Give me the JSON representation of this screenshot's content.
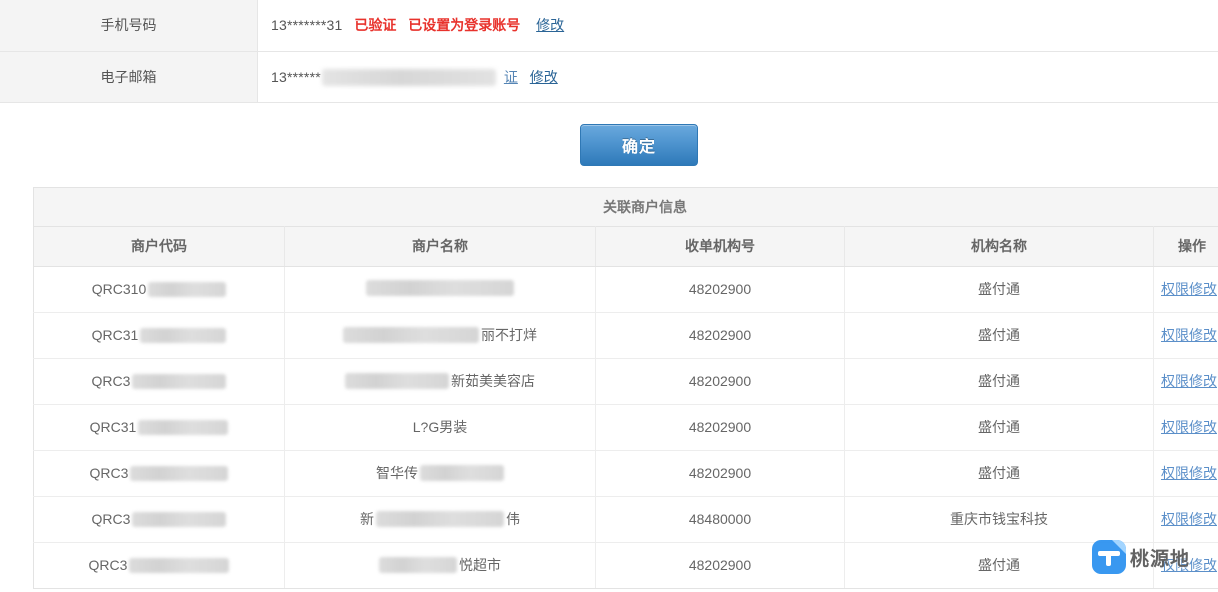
{
  "account_info": {
    "rows": [
      {
        "label": "手机号码",
        "value": "13*******31",
        "status_primary": "已验证",
        "status_secondary": "已设置为登录账号",
        "edit_link": "修改",
        "redacted": false
      },
      {
        "label": "电子邮箱",
        "value": "13******",
        "status_primary": "",
        "status_secondary": "",
        "verify_link": "证",
        "edit_link": "修改",
        "redacted": true
      }
    ]
  },
  "confirm_button": {
    "label": "确定"
  },
  "merchant_table": {
    "caption": "关联商户信息",
    "columns": [
      "商户代码",
      "商户名称",
      "收单机构号",
      "机构名称",
      "操作"
    ],
    "action_label": "权限修改",
    "rows": [
      {
        "code_prefix": "QRC310",
        "code_redact_width": 78,
        "name_prefix": "",
        "name_suffix": "",
        "name_redact_width": 148,
        "acq_no": "48202900",
        "org_name": "盛付通",
        "action": "权限修改"
      },
      {
        "code_prefix": "QRC31",
        "code_redact_width": 86,
        "name_prefix": "",
        "name_suffix": "丽不打烊",
        "name_redact_width": 136,
        "acq_no": "48202900",
        "org_name": "盛付通",
        "action": "权限修改"
      },
      {
        "code_prefix": "QRC3",
        "code_redact_width": 94,
        "name_prefix": "",
        "name_suffix": "新茹美美容店",
        "name_redact_width": 104,
        "acq_no": "48202900",
        "org_name": "盛付通",
        "action": "权限修改"
      },
      {
        "code_prefix": "QRC31",
        "code_redact_width": 90,
        "name_prefix": "L?G男装",
        "name_suffix": "",
        "name_redact_width": 0,
        "acq_no": "48202900",
        "org_name": "盛付通",
        "action": "权限修改"
      },
      {
        "code_prefix": "QRC3",
        "code_redact_width": 98,
        "name_prefix": "智华传",
        "name_suffix": "",
        "name_redact_width": 84,
        "acq_no": "48202900",
        "org_name": "盛付通",
        "action": "权限修改"
      },
      {
        "code_prefix": "QRC3",
        "code_redact_width": 94,
        "name_prefix": "新",
        "name_suffix": "伟",
        "name_redact_width": 128,
        "acq_no": "48480000",
        "org_name": "重庆市钱宝科技",
        "action": "权限修改"
      },
      {
        "code_prefix": "QRC3",
        "code_redact_width": 100,
        "name_prefix": "",
        "name_suffix": "悦超市",
        "name_redact_width": 78,
        "acq_no": "48202900",
        "org_name": "盛付通",
        "action": "权限修改"
      }
    ]
  },
  "watermark": {
    "text": "桃源地",
    "logo_letter": "T"
  },
  "colors": {
    "link": "#2a6496",
    "action_link": "#5b8fc9",
    "status_red": "#e8322c",
    "button_blue": "#2e79b9",
    "header_bg": "#f5f5f5",
    "label_bg": "#f4f4f4"
  }
}
